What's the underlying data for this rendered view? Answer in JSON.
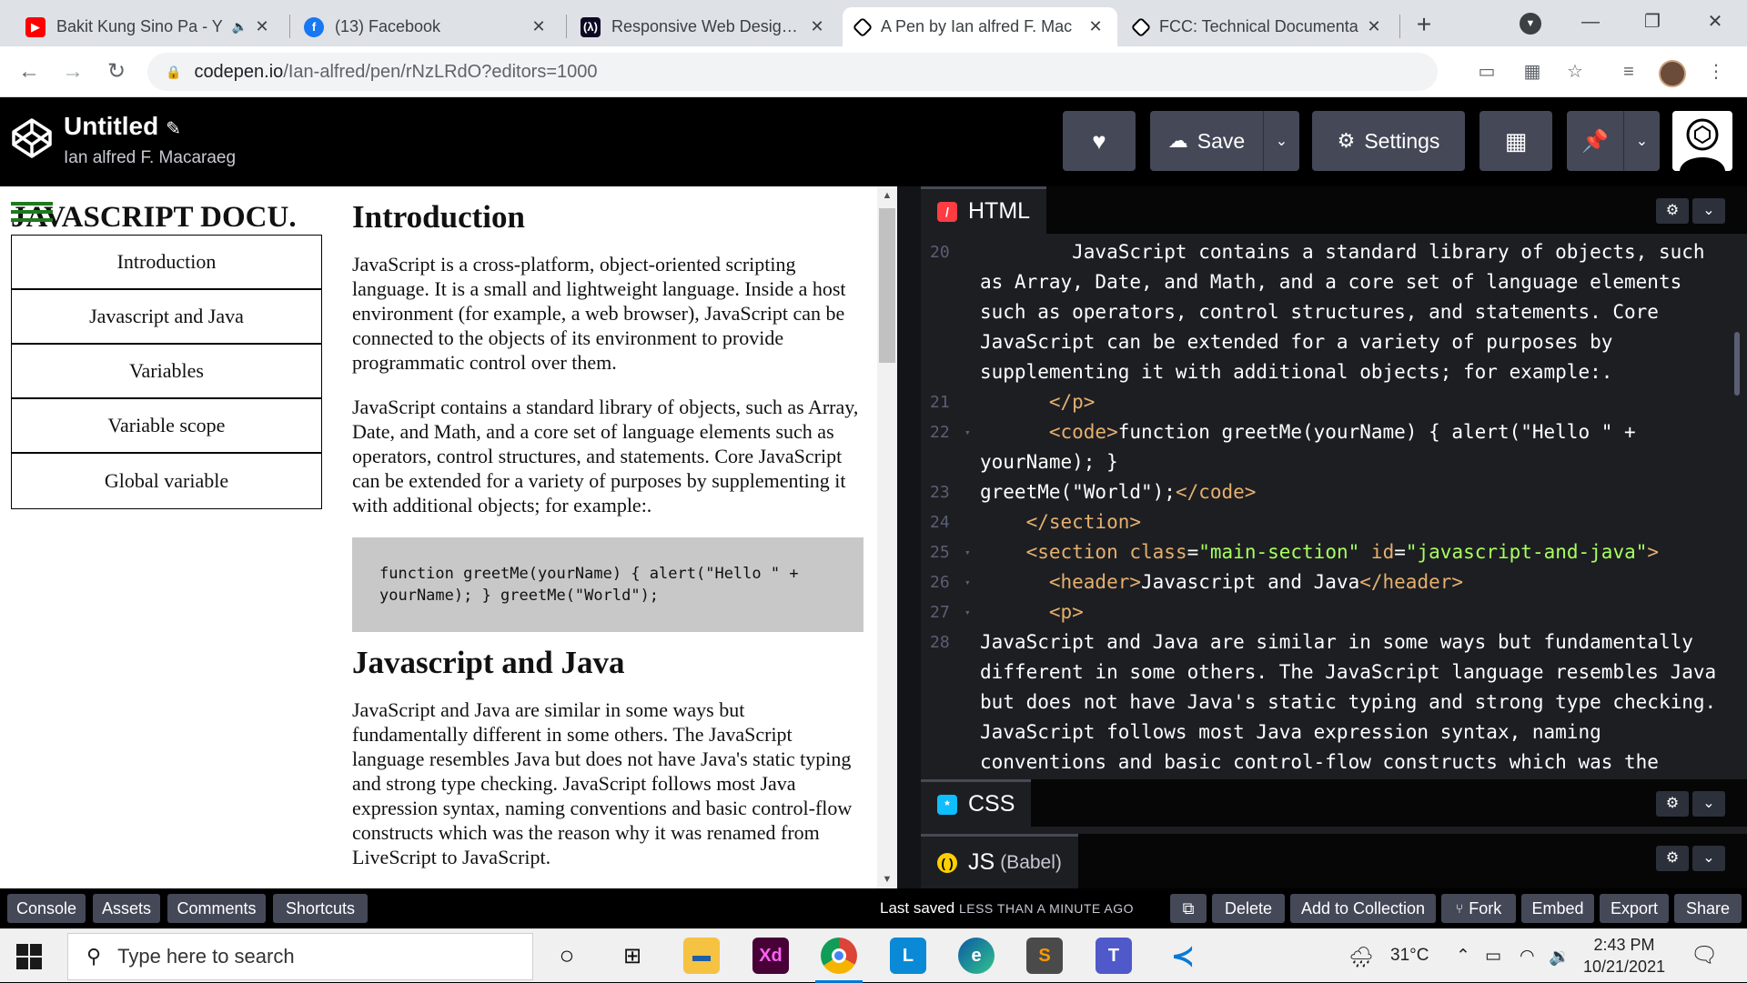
{
  "browser": {
    "tabs": [
      {
        "title": "Bakit Kung Sino Pa - Y",
        "favicon": "youtube-icon",
        "color": "#ff0000",
        "muted_icon": true
      },
      {
        "title": "(13) Facebook",
        "favicon": "facebook-icon",
        "color": "#1877f2"
      },
      {
        "title": "Responsive Web Design P",
        "favicon": "fcc-icon",
        "color": "#0a0a23"
      },
      {
        "title": "A Pen by Ian alfred F. Mac",
        "favicon": "codepen-icon",
        "color": "#000000",
        "active": true
      },
      {
        "title": "FCC: Technical Documenta",
        "favicon": "codepen-icon",
        "color": "#000000"
      }
    ],
    "url_host": "codepen.io",
    "url_path": "/Ian-alfred/pen/rNzLRdO?editors=1000"
  },
  "codepen": {
    "pen_title": "Untitled",
    "author": "Ian alfred F. Macaraeg",
    "buttons": {
      "save": "Save",
      "settings": "Settings"
    }
  },
  "preview": {
    "nav_heading": "JAVASCRIPT DOCU.",
    "nav_links": [
      "Introduction",
      "Javascript and Java",
      "Variables",
      "Variable scope",
      "Global variable"
    ],
    "sections": [
      {
        "title": "Introduction",
        "paragraphs": [
          "JavaScript is a cross-platform, object-oriented scripting language. It is a small and lightweight language. Inside a host environment (for example, a web browser), JavaScript can be connected to the objects of its environment to provide programmatic control over them.",
          "JavaScript contains a standard library of objects, such as Array, Date, and Math, and a core set of language elements such as operators, control structures, and statements. Core JavaScript can be extended for a variety of purposes by supplementing it with additional objects; for example:."
        ],
        "code": "function greetMe(yourName) { alert(\"Hello \" + yourName); } greetMe(\"World\");"
      },
      {
        "title": "Javascript and Java",
        "paragraphs": [
          "JavaScript and Java are similar in some ways but fundamentally different in some others. The JavaScript language resembles Java but does not have Java's static typing and strong type checking. JavaScript follows most Java expression syntax, naming conventions and basic control-flow constructs which was the reason why it was renamed from LiveScript to JavaScript."
        ]
      }
    ]
  },
  "editors": {
    "html_label": "HTML",
    "css_label": "CSS",
    "js_label": "JS",
    "js_sub": "(Babel)",
    "lines": [
      {
        "n": "20",
        "fold": false,
        "segments": [
          [
            "plain",
            "        JavaScript contains a standard library of objects, such"
          ]
        ]
      },
      {
        "n": "",
        "fold": false,
        "segments": [
          [
            "plain",
            "as Array, Date, and Math, and a core set of language elements"
          ]
        ]
      },
      {
        "n": "",
        "fold": false,
        "segments": [
          [
            "plain",
            "such as operators, control structures, and statements. Core"
          ]
        ]
      },
      {
        "n": "",
        "fold": false,
        "segments": [
          [
            "plain",
            "JavaScript can be extended for a variety of purposes by"
          ]
        ]
      },
      {
        "n": "",
        "fold": false,
        "segments": [
          [
            "plain",
            "supplementing it with additional objects; for example:."
          ]
        ]
      },
      {
        "n": "21",
        "fold": false,
        "segments": [
          [
            "tag",
            "      </p>"
          ]
        ]
      },
      {
        "n": "22",
        "fold": true,
        "segments": [
          [
            "tag",
            "      <code>"
          ],
          [
            "plain",
            "function greetMe(yourName) { alert(\"Hello \" +"
          ]
        ]
      },
      {
        "n": "",
        "fold": false,
        "segments": [
          [
            "plain",
            "yourName); }"
          ]
        ]
      },
      {
        "n": "23",
        "fold": false,
        "segments": [
          [
            "plain",
            "greetMe(\"World\");"
          ],
          [
            "tag",
            "</code>"
          ]
        ]
      },
      {
        "n": "24",
        "fold": false,
        "segments": [
          [
            "tag",
            "    </section>"
          ]
        ]
      },
      {
        "n": "25",
        "fold": true,
        "segments": [
          [
            "tag",
            "    <section "
          ],
          [
            "attr",
            "class"
          ],
          [
            "plain",
            "="
          ],
          [
            "val",
            "\"main-section\""
          ],
          [
            "plain",
            " "
          ],
          [
            "attr",
            "id"
          ],
          [
            "plain",
            "="
          ],
          [
            "val",
            "\"javascript-and-java\""
          ],
          [
            "tag",
            ">"
          ]
        ]
      },
      {
        "n": "26",
        "fold": true,
        "segments": [
          [
            "tag",
            "      <header>"
          ],
          [
            "plain",
            "Javascript and Java"
          ],
          [
            "tag",
            "</header>"
          ]
        ]
      },
      {
        "n": "27",
        "fold": true,
        "segments": [
          [
            "tag",
            "      <p>"
          ]
        ]
      },
      {
        "n": "28",
        "fold": false,
        "segments": [
          [
            "plain",
            "JavaScript and Java are similar in some ways but fundamentally"
          ]
        ]
      },
      {
        "n": "",
        "fold": false,
        "segments": [
          [
            "plain",
            "different in some others. The JavaScript language resembles Java"
          ]
        ]
      },
      {
        "n": "",
        "fold": false,
        "segments": [
          [
            "plain",
            "but does not have Java's static typing and strong type checking."
          ]
        ]
      },
      {
        "n": "",
        "fold": false,
        "segments": [
          [
            "plain",
            "JavaScript follows most Java expression syntax, naming"
          ]
        ]
      },
      {
        "n": "",
        "fold": false,
        "segments": [
          [
            "plain",
            "conventions and basic control-flow constructs which was the"
          ]
        ]
      }
    ]
  },
  "footer": {
    "left_buttons": [
      "Console",
      "Assets",
      "Comments",
      "Shortcuts"
    ],
    "status_prefix": "Last saved",
    "status_time": "LESS THAN A MINUTE AGO",
    "right_buttons": [
      "Delete",
      "Add to Collection",
      "Fork",
      "Embed",
      "Export",
      "Share"
    ]
  },
  "taskbar": {
    "search_placeholder": "Type here to search",
    "weather": "31°C",
    "time": "2:43 PM",
    "date": "10/21/2021"
  },
  "colors": {
    "codepen_button": "#444857",
    "editor_bg": "#1d1e22",
    "html_badge": "#ff3c41",
    "css_badge": "#0ebeff",
    "js_badge": "#fcd000",
    "hamburger": "#1e7a1e"
  }
}
